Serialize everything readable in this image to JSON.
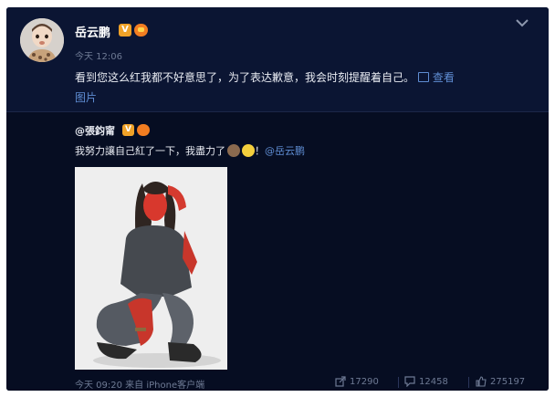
{
  "post": {
    "author": "岳云鹏",
    "verified_badge": "V",
    "time": "今天 12:06",
    "text": "看到您这么红我都不好意思了，为了表达歉意，我会时刻提醒着自己。",
    "view_pic_part1": "查看",
    "view_pic_part2": "图片"
  },
  "repost": {
    "author": "@張鈞甯",
    "verified_badge": "V",
    "text": "我努力讓自己紅了一下，我盡力了",
    "text_end": "！",
    "mention": "@岳云鹏",
    "meta": "今天 09:20 来自 iPhone客户端",
    "shares": "17290",
    "comments": "12458",
    "likes": "275197"
  },
  "colors": {
    "background": "#0b1533",
    "repost_background": "#060d22",
    "link": "#5f8dd3",
    "muted": "#6e7a94",
    "badge": "#f0a228"
  },
  "icons": [
    "chevron-down-icon",
    "image-icon",
    "share-icon",
    "comment-icon",
    "like-icon"
  ]
}
